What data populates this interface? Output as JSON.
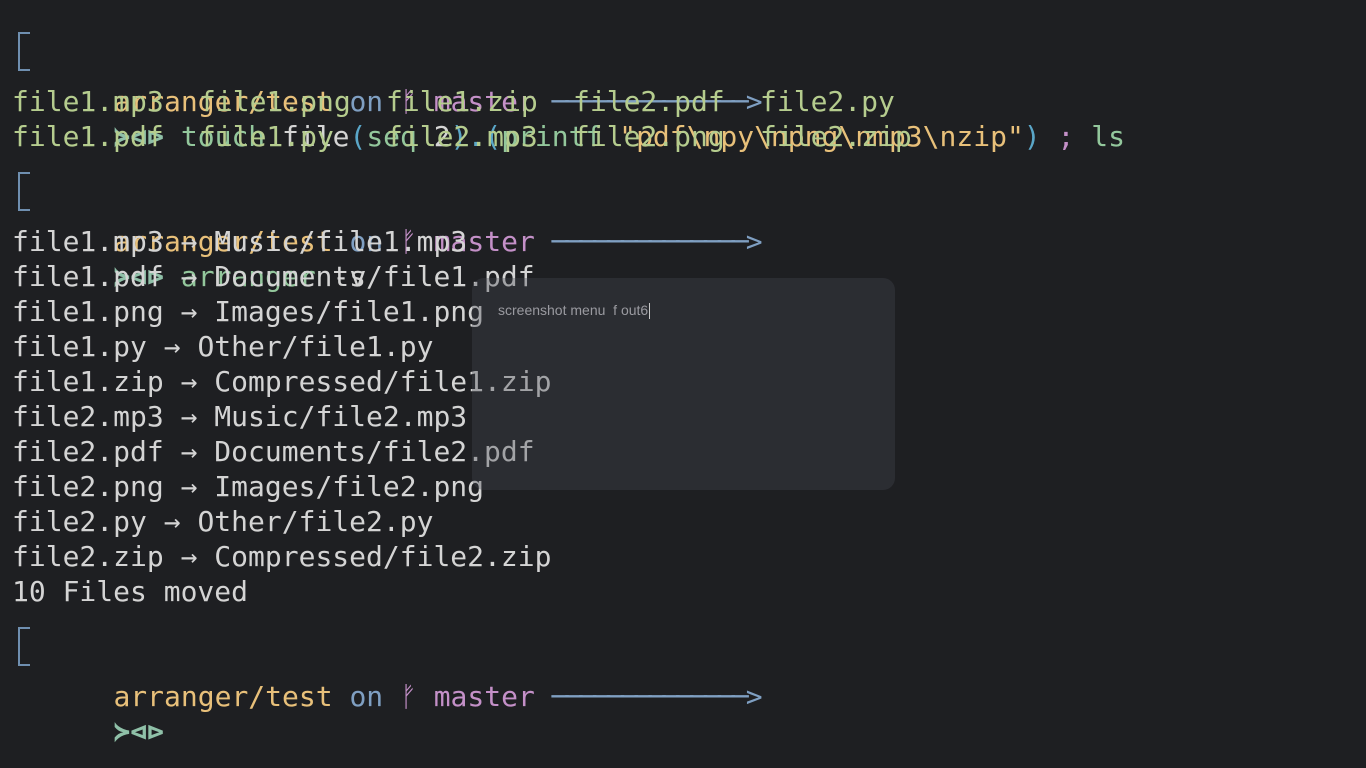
{
  "prompt": {
    "path": "arranger/test",
    "on_word": "on",
    "branch_glyph": "ᚠ",
    "branch": "master",
    "arrow_line": "──────────────",
    "arrow_head": ">",
    "symbol": "≻⊲⊳"
  },
  "command1": {
    "cmd": "touch",
    "arg1": "file",
    "open_paren": "(",
    "seq_cmd": "seq",
    "seq_arg": "2",
    "close_dot_paren": ").(",
    "printf_cmd": "printf",
    "space": " ",
    "string": "\"pdf\\npy\\npng\\nmp3\\nzip\"",
    "close_paren": ")",
    "semicolon": " ;",
    "ls_cmd": "ls"
  },
  "ls_output": [
    [
      "file1.mp3",
      "file1.png",
      "file1.zip",
      "file2.pdf",
      "file2.py"
    ],
    [
      "file1.pdf",
      "file1.py",
      "file2.mp3",
      "file2.png",
      "file2.zip"
    ]
  ],
  "command2": {
    "cmd": "arranger",
    "flag": " -v"
  },
  "moves": [
    {
      "src": "file1.mp3",
      "arrow": "→",
      "dst": "Music/file1.mp3"
    },
    {
      "src": "file1.pdf",
      "arrow": "→",
      "dst": "Documents/file1.pdf"
    },
    {
      "src": "file1.png",
      "arrow": "→",
      "dst": "Images/file1.png"
    },
    {
      "src": "file1.py",
      "arrow": "→",
      "dst": "Other/file1.py"
    },
    {
      "src": "file1.zip",
      "arrow": "→",
      "dst": "Compressed/file1.zip"
    },
    {
      "src": "file2.mp3",
      "arrow": "→",
      "dst": "Music/file2.mp3"
    },
    {
      "src": "file2.pdf",
      "arrow": "→",
      "dst": "Documents/file2.pdf"
    },
    {
      "src": "file2.png",
      "arrow": "→",
      "dst": "Images/file2.png"
    },
    {
      "src": "file2.py",
      "arrow": "→",
      "dst": "Other/file2.py"
    },
    {
      "src": "file2.zip",
      "arrow": "→",
      "dst": "Compressed/file2.zip"
    }
  ],
  "summary": "10 Files moved",
  "overlay": {
    "input_value": "screenshot menu  f out6"
  },
  "colors": {
    "background": "#1e1f22",
    "path": "#e8c07a",
    "branch": "#c490c8",
    "command": "#93c79c",
    "ls_files": "#b5cc8e"
  }
}
